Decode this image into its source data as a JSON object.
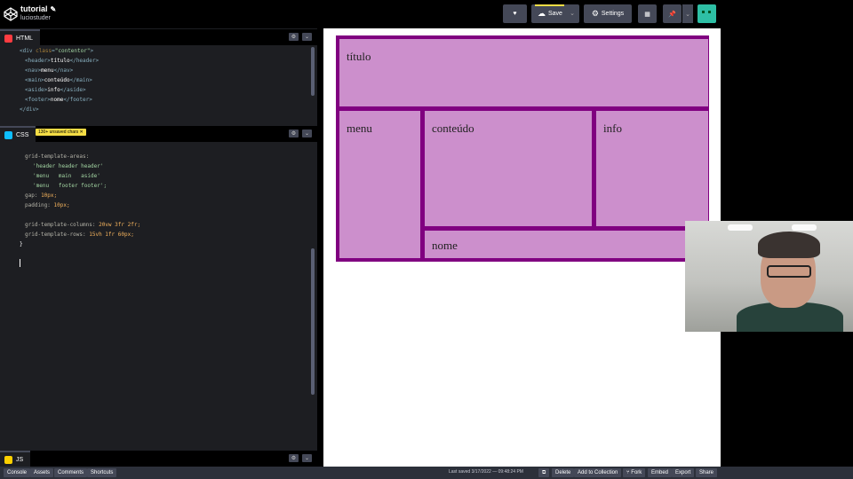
{
  "header": {
    "title": "tutorial",
    "author": "luciostuder",
    "save_label": "Save",
    "settings_label": "Settings"
  },
  "panes": {
    "html": {
      "label": "HTML",
      "badge_color": "#ff3c41"
    },
    "css": {
      "label": "CSS",
      "badge_color": "#0ebeff",
      "warning": "130+ unsaved chars"
    },
    "js": {
      "label": "JS",
      "badge_color": "#fcd000"
    }
  },
  "html_code": {
    "l1a": "<div ",
    "l1b": "class",
    "l1c": "=",
    "l1d": "\"contentor\"",
    "l1e": ">",
    "l2a": "<header>",
    "l2b": "título",
    "l2c": "</header>",
    "l3a": "<nav>",
    "l3b": "menu",
    "l3c": "</nav>",
    "l4a": "<main>",
    "l4b": "conteúdo",
    "l4c": "</main>",
    "l5a": "<aside>",
    "l5b": "info",
    "l5c": "</aside>",
    "l6a": "<footer>",
    "l6b": "nome",
    "l6c": "</footer>",
    "l7": "</div>"
  },
  "css_code": {
    "l1": "grid-template-areas:",
    "l2": "'header header header'",
    "l3": "'menu   main   aside'",
    "l4": "'menu   footer footer';",
    "l5a": "gap: ",
    "l5b": "10px;",
    "l6a": "padding: ",
    "l6b": "10px;",
    "l7a": "grid-template-columns: ",
    "l7b": "20vw 3fr 2fr;",
    "l8a": "grid-template-rows: ",
    "l8b": "15vh 1fr 60px;",
    "l9": "}"
  },
  "preview": {
    "header": "título",
    "menu": "menu",
    "main": "conteúdo",
    "aside": "info",
    "footer": "nome"
  },
  "bottombar": {
    "console": "Console",
    "assets": "Assets",
    "comments": "Comments",
    "shortcuts": "Shortcuts",
    "last_saved": "Last saved 3/17/2022 — 09:48:24 PM",
    "delete": "Delete",
    "add_collection": "Add to Collection",
    "fork": "Fork",
    "embed": "Embed",
    "export": "Export",
    "share": "Share"
  }
}
